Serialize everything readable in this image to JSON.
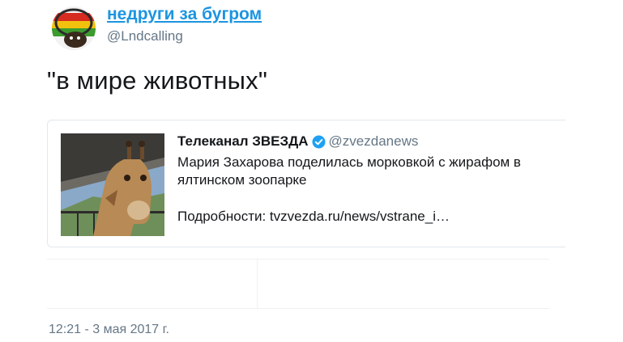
{
  "author": {
    "name": "недруги за бугром",
    "handle": "@Lndcalling"
  },
  "tweet": {
    "text": "\"в мире животных\"",
    "timestamp": "12:21 - 3 мая 2017 г."
  },
  "quote": {
    "author_name": "Телеканал ЗВЕЗДА",
    "author_handle": "@zvezdanews",
    "verified_icon": "verified-badge-icon",
    "body": "Мария Захарова поделилась морковкой с жирафом в ялтинском зоопарке",
    "link_text": "Подробности: tvzvezda.ru/news/vstrane_i…"
  },
  "colors": {
    "link_blue": "#1b95e0",
    "secondary_gray": "#657786",
    "border": "#e1e8ed"
  }
}
